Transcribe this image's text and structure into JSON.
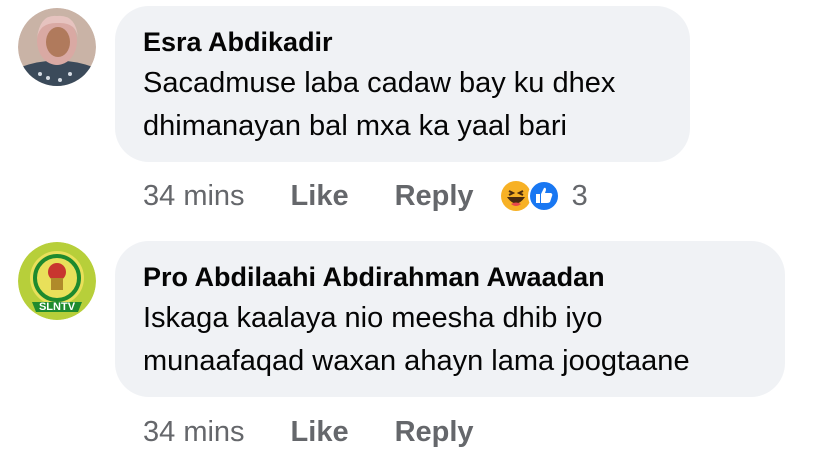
{
  "comments": [
    {
      "author": "Esra Abdikadir",
      "text_lines": [
        "Sacadmuse laba cadaw bay ku dhex",
        "dhimanayan bal mxa ka yaal bari"
      ],
      "time": "34 mins",
      "like_label": "Like",
      "reply_label": "Reply",
      "reaction_icons": [
        "laughing-face-icon",
        "thumbs-up-icon"
      ],
      "reaction_count": "3",
      "avatar_icon": "profile-photo-woman"
    },
    {
      "author": "Pro Abdilaahi Abdirahman Awaadan",
      "text_lines": [
        "Iskaga kaalaya nio meesha dhib iyo",
        "munaafaqad waxan ahayn lama joogtaane"
      ],
      "time": "34 mins",
      "like_label": "Like",
      "reply_label": "Reply",
      "avatar_icon": "slntv-logo",
      "avatar_logo_text": "SLNTV"
    }
  ],
  "colors": {
    "bubble": "#f0f2f5",
    "meta_text": "#65676b",
    "like_blue": "#1877f2",
    "laugh_yellow": "#f7b125",
    "logo_green": "#1e8a2e"
  }
}
